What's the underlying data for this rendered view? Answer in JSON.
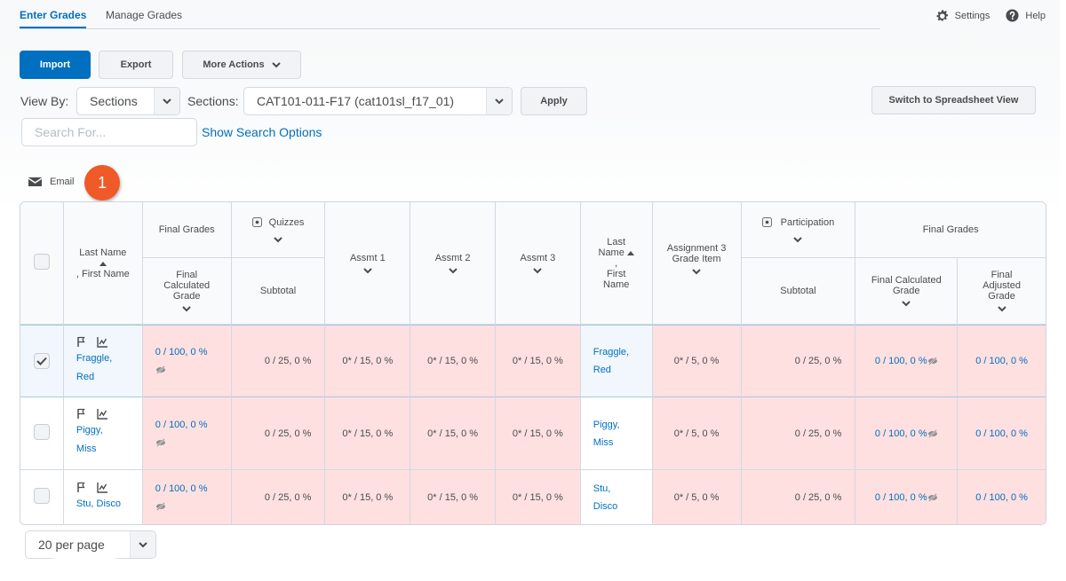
{
  "nav": {
    "tabs": [
      {
        "label": "Enter Grades",
        "active": true
      },
      {
        "label": "Manage Grades",
        "active": false
      }
    ],
    "settings_label": "Settings",
    "help_label": "Help"
  },
  "toolbar": {
    "import_label": "Import",
    "export_label": "Export",
    "more_actions_label": "More Actions",
    "switch_view_label": "Switch to Spreadsheet View",
    "apply_label": "Apply"
  },
  "filters": {
    "view_by_label": "View By:",
    "view_by_value": "Sections",
    "sections_label": "Sections:",
    "sections_value": "CAT101-011-F17 (cat101sl_f17_01)",
    "search_placeholder": "Search For...",
    "show_search_options": "Show Search Options"
  },
  "email_label": "Email",
  "callout_number": "1",
  "table": {
    "headers_top": {
      "name": [
        "Last Name",
        ", First Name"
      ],
      "final_grades_1": "Final Grades",
      "quizzes": "Quizzes",
      "assmt1": "Assmt 1",
      "assmt2": "Assmt 2",
      "assmt3": "Assmt 3",
      "name2": [
        "Last",
        "Name",
        ",",
        "First",
        "Name"
      ],
      "assignment3": [
        "Assignment 3",
        "Grade Item"
      ],
      "participation": "Participation",
      "final_grades_2": "Final Grades"
    },
    "headers_sub": {
      "final_calc_1": [
        "Final",
        "Calculated",
        "Grade"
      ],
      "quizzes_subtotal": "Subtotal",
      "participation_subtotal": "Subtotal",
      "final_calc_2": [
        "Final Calculated",
        "Grade"
      ],
      "final_adjusted": [
        "Final",
        "Adjusted",
        "Grade"
      ]
    },
    "rows": [
      {
        "checked": true,
        "last": "Fraggle,",
        "first": "Red",
        "final_calc": "0 / 100, 0 %",
        "quizzes_subtotal": "0 / 25, 0 %",
        "assmt1": "0* / 15, 0 %",
        "assmt2": "0* / 15, 0 %",
        "assmt3": "0* / 15, 0 %",
        "assignment3": "0* / 5, 0 %",
        "participation_subtotal": "0 / 25, 0 %",
        "final_calc_2": "0 / 100, 0 %",
        "final_adjusted": "0 / 100, 0 %"
      },
      {
        "checked": false,
        "last": "Piggy,",
        "first": "Miss",
        "final_calc": "0 / 100, 0 %",
        "quizzes_subtotal": "0 / 25, 0 %",
        "assmt1": "0* / 15, 0 %",
        "assmt2": "0* / 15, 0 %",
        "assmt3": "0* / 15, 0 %",
        "assignment3": "0* / 5, 0 %",
        "participation_subtotal": "0 / 25, 0 %",
        "final_calc_2": "0 / 100, 0 %",
        "final_adjusted": "0 / 100, 0 %"
      },
      {
        "checked": false,
        "last": "Stu,",
        "first": "Disco",
        "full_name": "Stu, Disco",
        "final_calc": "0 / 100, 0 %",
        "quizzes_subtotal": "0 / 25, 0 %",
        "assmt1": "0* / 15, 0 %",
        "assmt2": "0* / 15, 0 %",
        "assmt3": "0* / 15, 0 %",
        "assignment3": "0* / 5, 0 %",
        "participation_subtotal": "0 / 25, 0 %",
        "final_calc_2": "0 / 100, 0 %",
        "final_adjusted": "0 / 100, 0 %"
      }
    ]
  },
  "pagination": {
    "per_page": "20 per page"
  },
  "colors": {
    "accent": "#006fbf",
    "callout": "#ef5a28",
    "failing_cell": "#ffe0e0",
    "selected_row": "#f1f7fc"
  }
}
